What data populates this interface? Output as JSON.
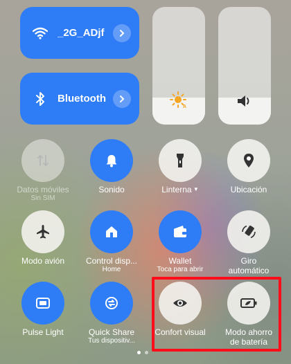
{
  "tiles": {
    "wifi": {
      "label": "_2G_ADjf",
      "icon": "wifi-icon"
    },
    "bluetooth": {
      "label": "Bluetooth",
      "icon": "bluetooth-icon"
    }
  },
  "sliders": {
    "brightness": {
      "icon": "brightness-auto-icon",
      "level": 0.23
    },
    "volume": {
      "icon": "volume-icon",
      "level": 0.23
    }
  },
  "toggles": [
    {
      "label": "Datos móviles",
      "sub": "Sin SIM",
      "icon": "mobile-data-icon",
      "state": "disabled"
    },
    {
      "label": "Sonido",
      "sub": "",
      "icon": "bell-icon",
      "state": "on"
    },
    {
      "label": "Linterna",
      "sub": "",
      "icon": "flashlight-icon",
      "state": "off"
    },
    {
      "label": "Ubicación",
      "sub": "",
      "icon": "location-icon",
      "state": "off"
    },
    {
      "label": "Modo avión",
      "sub": "",
      "icon": "airplane-icon",
      "state": "off"
    },
    {
      "label": "Control disp...",
      "sub": "Home",
      "icon": "home-icon",
      "state": "on"
    },
    {
      "label": "Wallet",
      "sub": "Toca para abrir",
      "icon": "wallet-icon",
      "state": "on"
    },
    {
      "label": "Giro",
      "label2": "automático",
      "sub": "",
      "icon": "auto-rotate-icon",
      "state": "off"
    },
    {
      "label": "Pulse Light",
      "sub": "",
      "icon": "pulse-light-icon",
      "state": "on"
    },
    {
      "label": "Quick Share",
      "sub": "Tus dispositiv...",
      "icon": "quick-share-icon",
      "state": "on"
    },
    {
      "label": "Confort visual",
      "sub": "",
      "icon": "eye-icon",
      "state": "off"
    },
    {
      "label": "Modo ahorro",
      "label2": "de batería",
      "sub": "",
      "icon": "battery-saver-icon",
      "state": "off"
    }
  ],
  "colors": {
    "accent": "#2f7df6",
    "highlight": "#ff0d1a"
  }
}
